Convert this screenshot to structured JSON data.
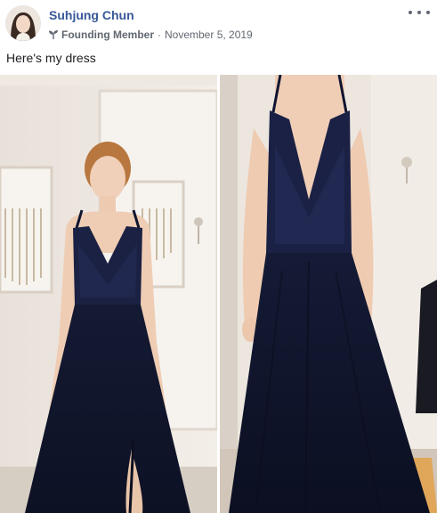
{
  "post": {
    "author_name": "Suhjung Chun",
    "badge_icon": "sprout-icon",
    "badge_label": "Founding Member",
    "separator": "·",
    "date": "November 5, 2019",
    "text": "Here's my dress",
    "more_icon": "more-options-icon"
  },
  "colors": {
    "author_link": "#385898",
    "meta_text": "#606770",
    "badge_green": "#42b72a",
    "dress_navy": "#141a33"
  }
}
